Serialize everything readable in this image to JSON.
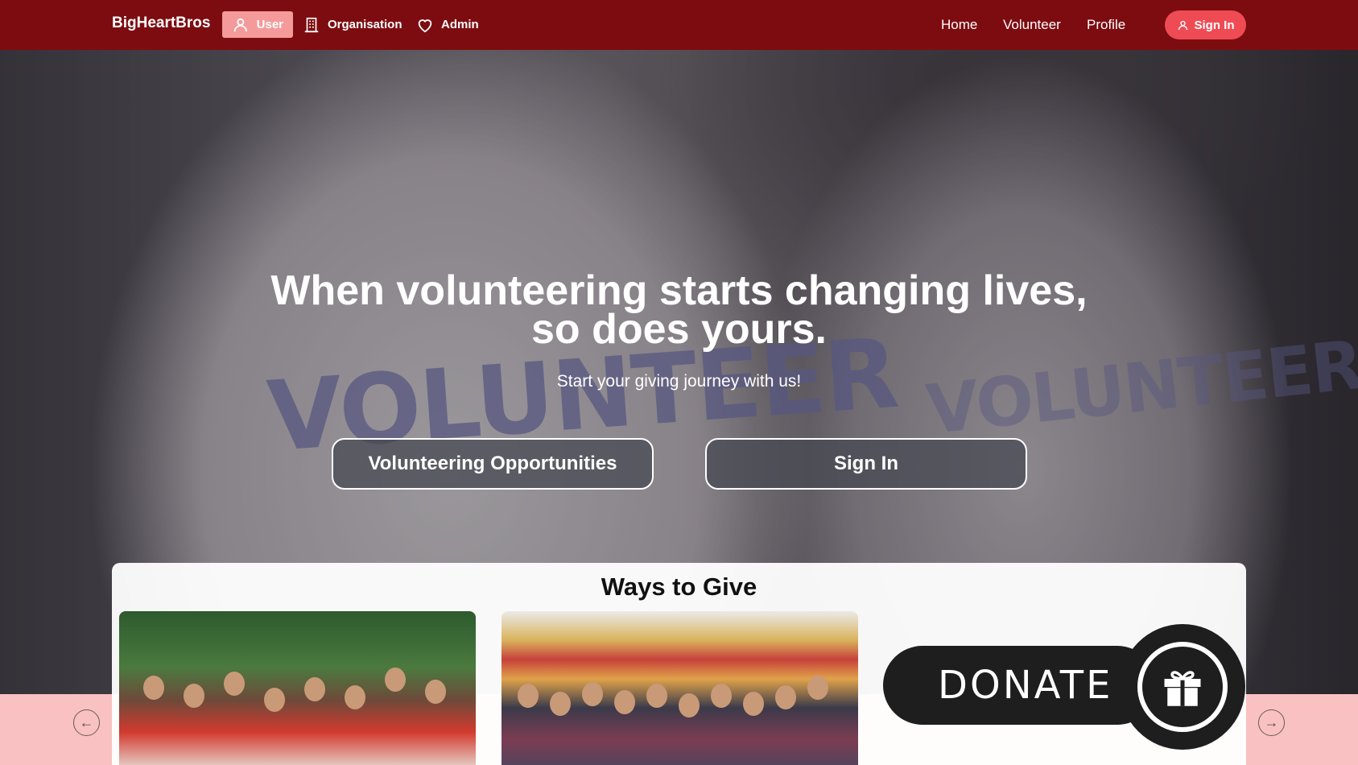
{
  "nav": {
    "brand": "BigHeartBros",
    "role_tabs": [
      {
        "label": "User",
        "icon": "user-icon",
        "active": true
      },
      {
        "label": "Organisation",
        "icon": "building-icon",
        "active": false
      },
      {
        "label": "Admin",
        "icon": "heart-icon",
        "active": false
      }
    ],
    "links": [
      "Home",
      "Volunteer",
      "Profile"
    ],
    "signin_label": "Sign In",
    "signin_icon": "user-icon"
  },
  "hero": {
    "background_text_left": "VOLUNTEER",
    "background_text_right": "VOLUNTEER",
    "title_line1": "When volunteering starts changing lives,",
    "title_line2": "so does yours.",
    "subtitle": "Start your giving journey with us!",
    "buttons": {
      "opportunities": "Volunteering Opportunities",
      "signin": "Sign In"
    }
  },
  "ways_to_give": {
    "title": "Ways to Give",
    "cards": [
      {
        "image": "volunteer-group-photo-1"
      },
      {
        "image": "volunteer-group-photo-2"
      },
      {
        "image": "donate-graphic",
        "text": "DONATE",
        "icon": "gift-icon"
      }
    ]
  },
  "carousel": {
    "prev_icon": "arrow-left-icon",
    "next_icon": "arrow-right-icon"
  },
  "colors": {
    "nav_bg": "#7d0c10",
    "active_tab": "#f49a9a",
    "signin_pill": "#ee4b55",
    "pink_strip": "#f9c1c1"
  }
}
